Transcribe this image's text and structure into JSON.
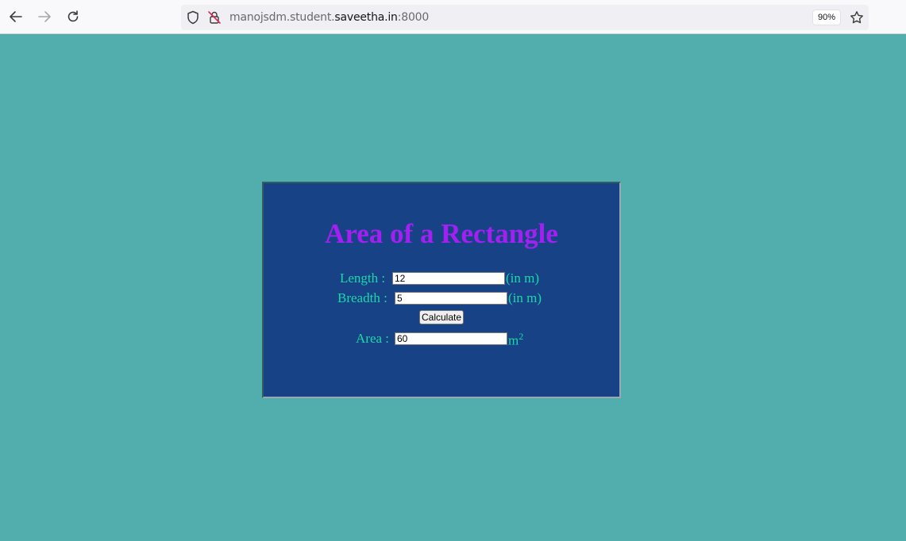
{
  "browser": {
    "url_prefix": "manojsdm.student.",
    "url_domain": "saveetha.in",
    "url_suffix": ":8000",
    "zoom": "90%"
  },
  "page": {
    "title": "Area of a Rectangle",
    "length_label": "Length :",
    "length_value": "12",
    "length_unit": "(in m)",
    "breadth_label": "Breadth :",
    "breadth_value": "5",
    "breadth_unit": "(in m)",
    "button_label": "Calculate",
    "area_label": "Area :",
    "area_value": "60",
    "area_unit": "m",
    "area_unit_exp": "2"
  },
  "colors": {
    "page_bg": "#52adad",
    "card_bg": "#174386",
    "title": "#a31ff2",
    "label": "#1bd8a8"
  }
}
